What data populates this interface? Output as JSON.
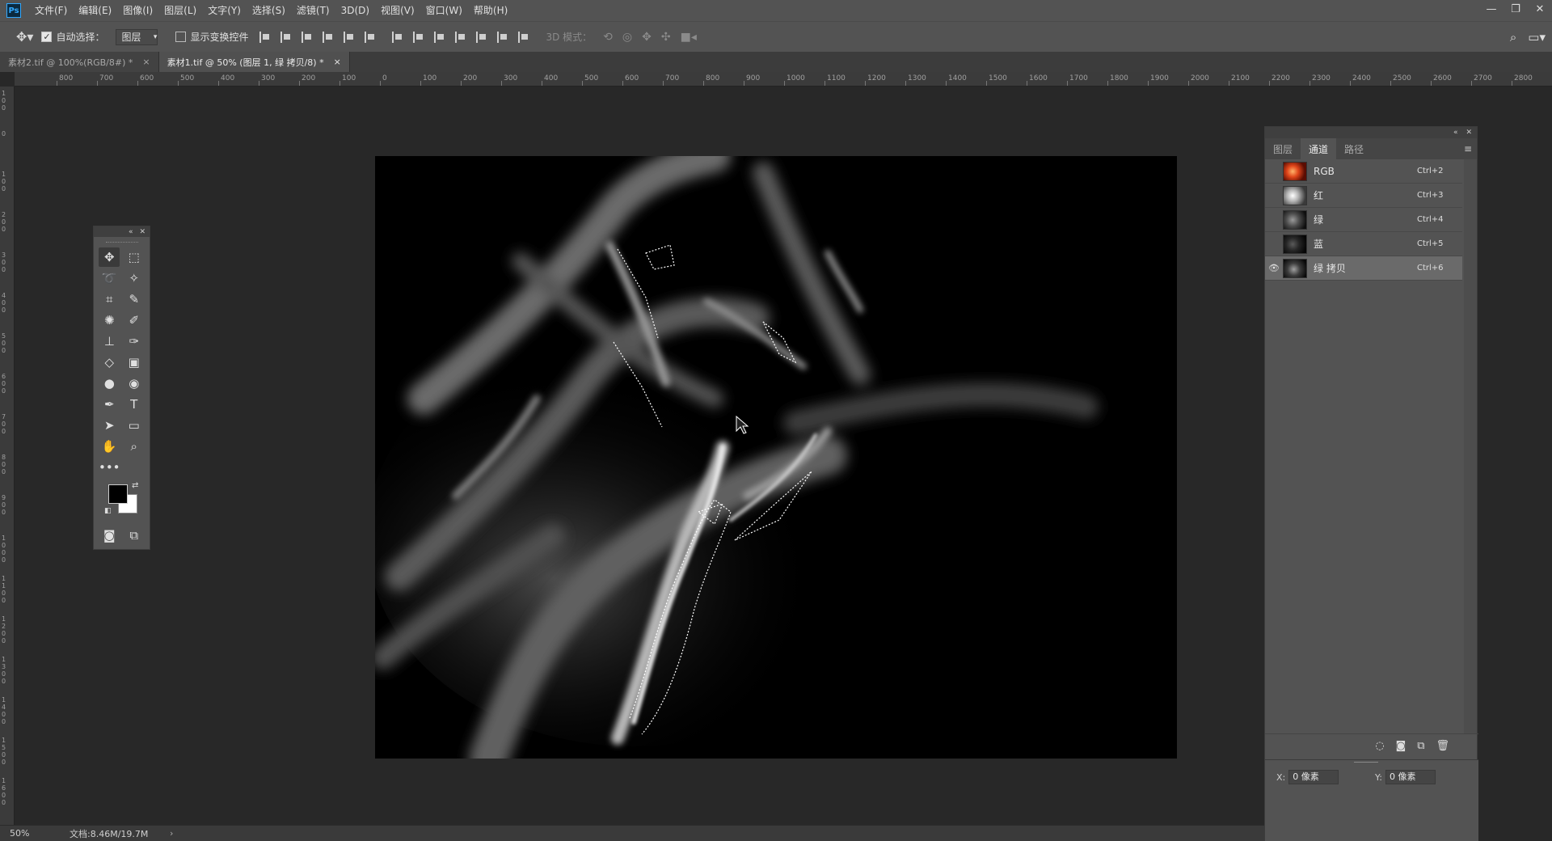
{
  "app": {
    "logo": "Ps"
  },
  "menu": [
    "文件(F)",
    "编辑(E)",
    "图像(I)",
    "图层(L)",
    "文字(Y)",
    "选择(S)",
    "滤镜(T)",
    "3D(D)",
    "视图(V)",
    "窗口(W)",
    "帮助(H)"
  ],
  "window_controls": {
    "minimize": "—",
    "restore": "❐",
    "close": "✕"
  },
  "options": {
    "auto_select_label": "自动选择：",
    "auto_select_checked": "✓",
    "auto_select_target": "图层",
    "show_transform_label": "显示变换控件",
    "mode_3d_label": "3D 模式："
  },
  "tabs": [
    {
      "title": "素材2.tif @ 100%(RGB/8#) *",
      "close": "×"
    },
    {
      "title": "素材1.tif @ 50% (图层 1, 绿 拷贝/8) *",
      "close": "×"
    }
  ],
  "ruler_top": [
    "800",
    "700",
    "600",
    "500",
    "400",
    "300",
    "200",
    "100",
    "0",
    "100",
    "200",
    "300",
    "400",
    "500",
    "600",
    "700",
    "800",
    "900",
    "1000",
    "1100",
    "1200",
    "1300",
    "1400",
    "1500",
    "1600",
    "1700",
    "1800",
    "1900",
    "2000",
    "2100",
    "2200",
    "2300",
    "2400",
    "2500",
    "2600",
    "2700",
    "2800"
  ],
  "ruler_left": [
    "100",
    "0",
    "100",
    "200",
    "300",
    "400",
    "500",
    "600",
    "700",
    "800",
    "900",
    "1000",
    "1100",
    "1200",
    "1300",
    "1400",
    "1500",
    "1600"
  ],
  "channels_panel": {
    "tabs": [
      "图层",
      "通道",
      "路径"
    ],
    "active_tab": "通道",
    "channels": [
      {
        "name": "RGB",
        "shortcut": "Ctrl+2",
        "visible": false
      },
      {
        "name": "红",
        "shortcut": "Ctrl+3",
        "visible": false
      },
      {
        "name": "绿",
        "shortcut": "Ctrl+4",
        "visible": false
      },
      {
        "name": "蓝",
        "shortcut": "Ctrl+5",
        "visible": false
      },
      {
        "name": "绿 拷贝",
        "shortcut": "Ctrl+6",
        "visible": true
      }
    ],
    "eye_glyph": "👁"
  },
  "info": {
    "x_label": "X:",
    "x_value": "0 像素",
    "y_label": "Y:",
    "y_value": "0 像素"
  },
  "status": {
    "zoom": "50%",
    "doc_size": "文档:8.46M/19.7M",
    "arrow": "›"
  },
  "colors": {
    "foreground": "#000000",
    "background": "#ffffff",
    "accent": "#31a8ff"
  }
}
